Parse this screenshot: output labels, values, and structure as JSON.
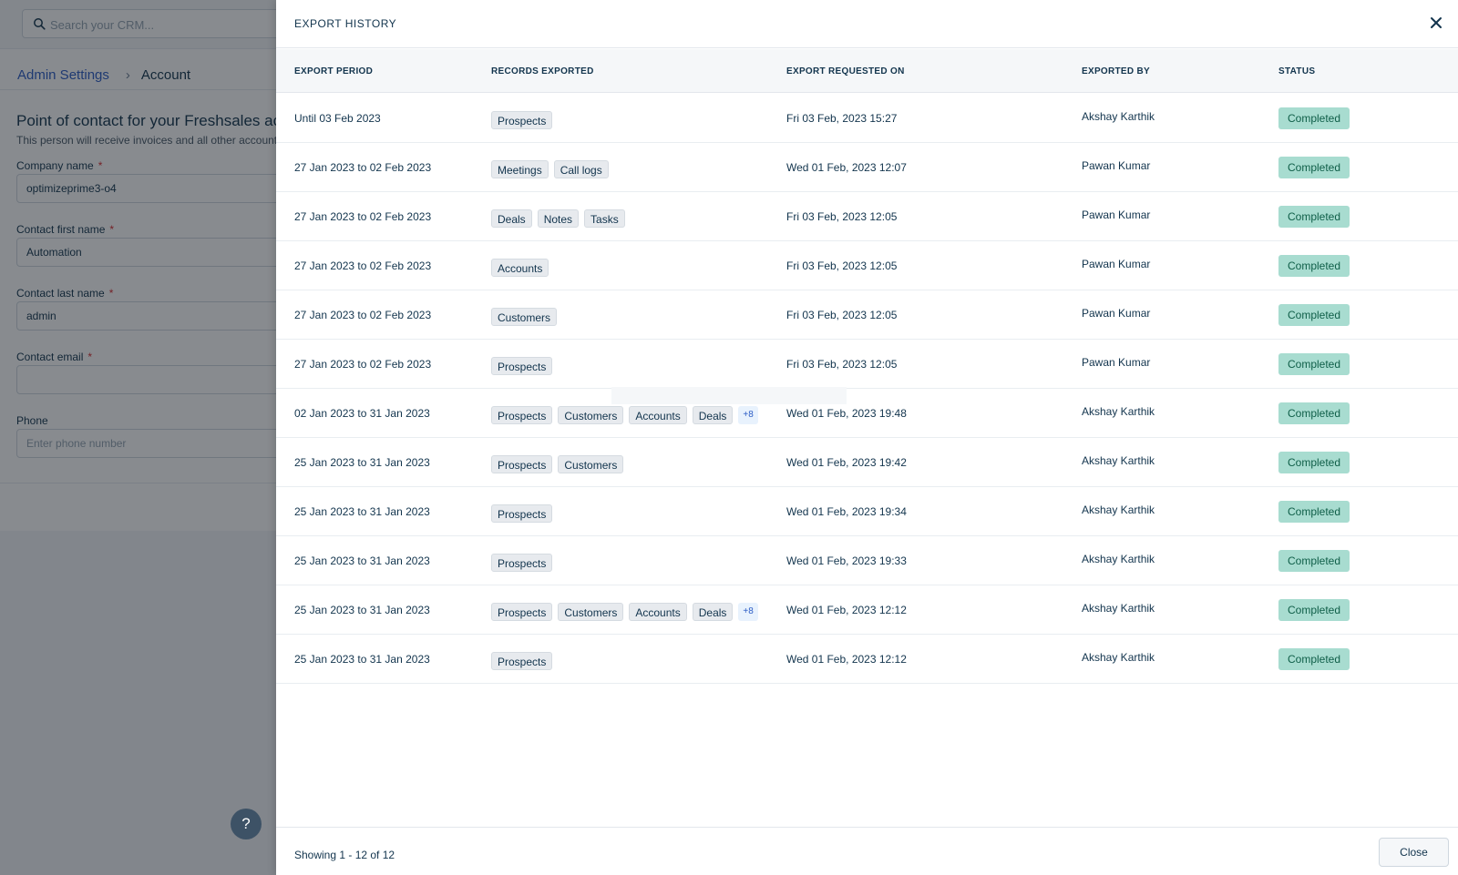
{
  "background": {
    "search": {
      "placeholder": "Search your CRM..."
    },
    "breadcrumb": {
      "parent": "Admin Settings",
      "separator": "›",
      "current": "Account"
    },
    "section": {
      "title": "Point of contact for your Freshsales account",
      "subtitle": "This person will receive invoices and all other account related communication"
    },
    "fields": {
      "company_name": {
        "label": "Company name",
        "value": "optimizeprime3-o4"
      },
      "first_name": {
        "label": "Contact first name",
        "value": "Automation"
      },
      "last_name": {
        "label": "Contact last name",
        "value": "admin"
      },
      "email": {
        "label": "Contact email",
        "value": ""
      },
      "phone": {
        "label": "Phone",
        "placeholder": "Enter phone number"
      },
      "required_mark": "*"
    },
    "help_label": "?"
  },
  "modal": {
    "title": "EXPORT HISTORY",
    "columns": {
      "period": "EXPORT PERIOD",
      "records": "RECORDS EXPORTED",
      "requested": "EXPORT REQUESTED ON",
      "by": "EXPORTED BY",
      "status": "STATUS"
    },
    "rows": [
      {
        "period": "Until 03 Feb 2023",
        "records": [
          "Prospects"
        ],
        "more": "",
        "requested": "Fri 03 Feb, 2023 15:27",
        "by": "Akshay Karthik",
        "status": "Completed"
      },
      {
        "period": "27 Jan 2023 to 02 Feb 2023",
        "records": [
          "Meetings",
          "Call logs"
        ],
        "more": "",
        "requested": "Wed 01 Feb, 2023 12:07",
        "by": "Pawan Kumar",
        "status": "Completed"
      },
      {
        "period": "27 Jan 2023 to 02 Feb 2023",
        "records": [
          "Deals",
          "Notes",
          "Tasks"
        ],
        "more": "",
        "requested": "Fri 03 Feb, 2023 12:05",
        "by": "Pawan Kumar",
        "status": "Completed"
      },
      {
        "period": "27 Jan 2023 to 02 Feb 2023",
        "records": [
          "Accounts"
        ],
        "more": "",
        "requested": "Fri 03 Feb, 2023 12:05",
        "by": "Pawan Kumar",
        "status": "Completed"
      },
      {
        "period": "27 Jan 2023 to 02 Feb 2023",
        "records": [
          "Customers"
        ],
        "more": "",
        "requested": "Fri 03 Feb, 2023 12:05",
        "by": "Pawan Kumar",
        "status": "Completed"
      },
      {
        "period": "27 Jan 2023 to 02 Feb 2023",
        "records": [
          "Prospects"
        ],
        "more": "",
        "requested": "Fri 03 Feb, 2023 12:05",
        "by": "Pawan Kumar",
        "status": "Completed"
      },
      {
        "period": "02 Jan 2023 to 31 Jan 2023",
        "records": [
          "Prospects",
          "Customers",
          "Accounts",
          "Deals"
        ],
        "more": "+8",
        "requested": "Wed 01 Feb, 2023 19:48",
        "by": "Akshay Karthik",
        "status": "Completed"
      },
      {
        "period": "25 Jan 2023 to 31 Jan 2023",
        "records": [
          "Prospects",
          "Customers"
        ],
        "more": "",
        "requested": "Wed 01 Feb, 2023 19:42",
        "by": "Akshay Karthik",
        "status": "Completed"
      },
      {
        "period": "25 Jan 2023 to 31 Jan 2023",
        "records": [
          "Prospects"
        ],
        "more": "",
        "requested": "Wed 01 Feb, 2023 19:34",
        "by": "Akshay Karthik",
        "status": "Completed"
      },
      {
        "period": "25 Jan 2023 to 31 Jan 2023",
        "records": [
          "Prospects"
        ],
        "more": "",
        "requested": "Wed 01 Feb, 2023 19:33",
        "by": "Akshay Karthik",
        "status": "Completed"
      },
      {
        "period": "25 Jan 2023 to 31 Jan 2023",
        "records": [
          "Prospects",
          "Customers",
          "Accounts",
          "Deals"
        ],
        "more": "+8",
        "requested": "Wed 01 Feb, 2023 12:12",
        "by": "Akshay Karthik",
        "status": "Completed"
      },
      {
        "period": "25 Jan 2023 to 31 Jan 2023",
        "records": [
          "Prospects"
        ],
        "more": "",
        "requested": "Wed 01 Feb, 2023 12:12",
        "by": "Akshay Karthik",
        "status": "Completed"
      }
    ],
    "footer": {
      "showing": "Showing 1 - 12 of 12",
      "close_label": "Close"
    }
  },
  "colors": {
    "accent_link": "#2c5cc5",
    "status_completed_bg": "#a8dcd0",
    "status_completed_text": "#0f5e48",
    "tag_bg": "#e7eaee"
  }
}
